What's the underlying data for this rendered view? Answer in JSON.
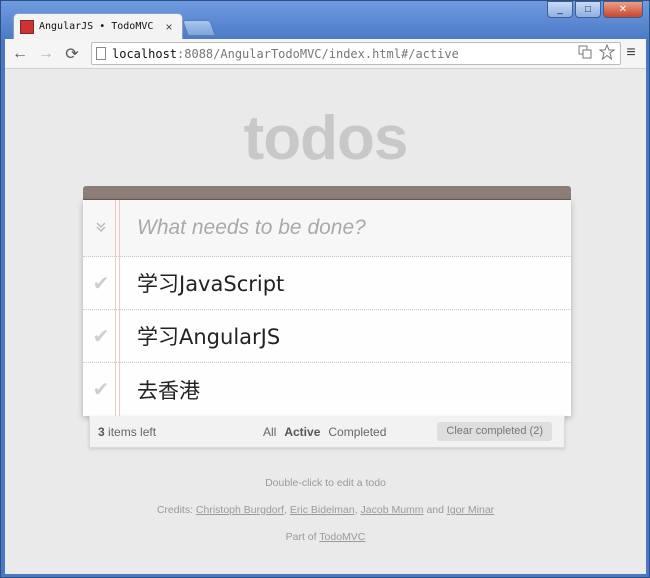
{
  "browser": {
    "tab_title": "AngularJS • TodoMVC",
    "tab_close": "×",
    "url_host": "localhost",
    "url_rest": ":8088/AngularTodoMVC/index.html#/active",
    "back_icon": "←",
    "forward_icon": "→",
    "reload_icon": "⟳",
    "menu_icon": "≡",
    "minimize_icon": "_",
    "maximize_icon": "□",
    "close_icon": "✕"
  },
  "app": {
    "title": "todos",
    "new_todo_placeholder": "What needs to be done?",
    "toggle_all_icon": "»",
    "todos": [
      {
        "label": "学习JavaScript",
        "check": "✔"
      },
      {
        "label": "学习AngularJS",
        "check": "✔"
      },
      {
        "label": "去香港",
        "check": "✔"
      }
    ],
    "footer": {
      "count": "3",
      "count_suffix": " items left",
      "filters": [
        "All",
        "Active",
        "Completed"
      ],
      "selected_filter": "Active",
      "clear_label": "Clear completed (2)"
    }
  },
  "info": {
    "hint": "Double-click to edit a todo",
    "credits_prefix": "Credits: ",
    "credits": [
      "Christoph Burgdorf",
      "Eric Bidelman",
      "Jacob Mumm",
      "Igor Minar"
    ],
    "comma": ", ",
    "and": " and ",
    "part_of_prefix": "Part of ",
    "part_of_link": "TodoMVC"
  }
}
